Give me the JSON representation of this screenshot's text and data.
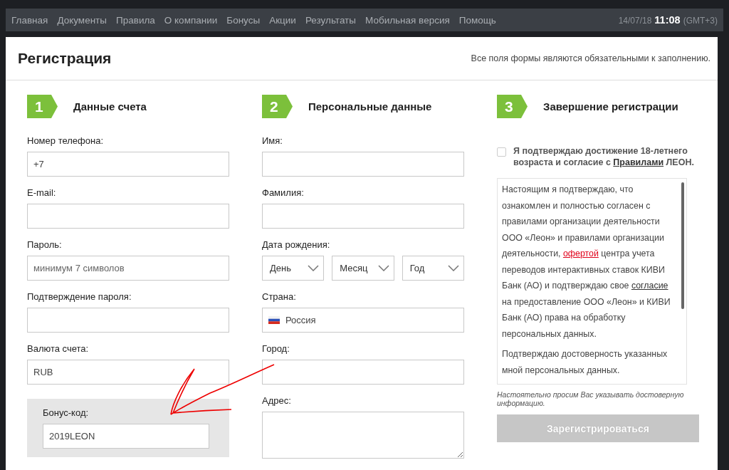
{
  "nav": {
    "items": [
      "Главная",
      "Документы",
      "Правила",
      "О компании",
      "Бонусы",
      "Акции",
      "Результаты",
      "Мобильная версия",
      "Помощь"
    ],
    "date": "14/07/18",
    "time": "11:08",
    "timezone": "(GMT+3)"
  },
  "page": {
    "title": "Регистрация",
    "note": "Все поля формы являются обязательными к заполнению."
  },
  "steps": [
    {
      "number": "1",
      "title": "Данные счета"
    },
    {
      "number": "2",
      "title": "Персональные данные"
    },
    {
      "number": "3",
      "title": "Завершение регистрации"
    }
  ],
  "account_fields": [
    {
      "kind": "text",
      "label": "Номер телефона:",
      "value": "+7"
    },
    {
      "kind": "text",
      "label": "E-mail:"
    },
    {
      "kind": "text",
      "label": "Пароль:",
      "placeholder": "минимум 7 символов"
    },
    {
      "kind": "text",
      "label": "Подтверждение пароля:"
    },
    {
      "kind": "text",
      "label": "Валюта счета:",
      "value": "RUB"
    }
  ],
  "bonus": {
    "label": "Бонус-код:",
    "value": "2019LEON"
  },
  "personal_fields": [
    {
      "kind": "text",
      "label": "Имя:"
    },
    {
      "kind": "text",
      "label": "Фамилия:"
    },
    {
      "kind": "date",
      "label": "Дата рождения:",
      "selects": [
        "День",
        "Месяц",
        "Год"
      ]
    },
    {
      "kind": "country",
      "label": "Страна:",
      "value": "Россия"
    },
    {
      "kind": "text",
      "label": "Город:"
    },
    {
      "kind": "textarea",
      "label": "Адрес:"
    }
  ],
  "confirm": {
    "checked": false,
    "text_before": "Я подтверждаю достижение 18-летнего возраста и согласие с",
    "link": "Правилами",
    "text_after": "ЛЕОН."
  },
  "agreement": {
    "paragraphs": [
      [
        {
          "kind": "text",
          "text": "Настоящим я подтверждаю, что ознакомлен и полностью согласен с правилами организации деятельности ООО «Леон» и правилами организации деятельности, "
        },
        {
          "kind": "accent_link",
          "text": "офертой"
        },
        {
          "kind": "text",
          "text": " центра учета переводов интерактивных ставок КИВИ Банк (АО) и подтверждаю свое "
        },
        {
          "kind": "link",
          "text": "согласие"
        },
        {
          "kind": "text",
          "text": " на предоставление ООО «Леон» и КИВИ Банк (АО) права на обработку персональных данных."
        }
      ],
      [
        {
          "kind": "text",
          "text": "Подтверждаю достоверность указанных мной персональных данных."
        }
      ]
    ]
  },
  "hint": "Настоятельно просим Вас указывать достоверную информацию.",
  "submit": {
    "label": "Зарегистрироваться",
    "disabled": true
  }
}
